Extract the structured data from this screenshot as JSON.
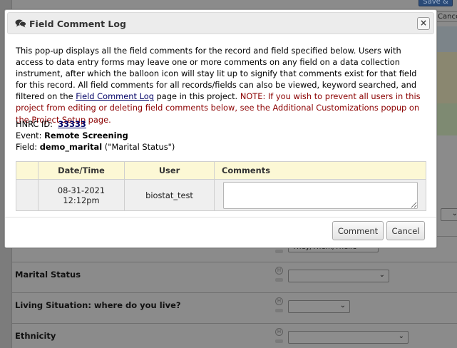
{
  "background": {
    "top_button_label": "Save &",
    "right_button_label": "Cancel",
    "select_partial_value": "They/Them/Theirs",
    "fields": [
      {
        "label": "Marital Status"
      },
      {
        "label": "Living Situation: where do you live?"
      },
      {
        "label": "Ethnicity"
      }
    ]
  },
  "dialog": {
    "title": "Field Comment Log",
    "close_label": "×",
    "intro_text": "This pop-up displays all the field comments for the record and field specified below. Users with access to data entry forms may leave one or more comments on any field on a data collection instrument, after which the balloon icon will stay lit up to signify that comments exist for that field for this record. All field comments for all records/fields can also be viewed, keyword searched, and filtered on the ",
    "intro_link": "Field Comment Log",
    "intro_tail": " page in this project. ",
    "note": "NOTE: If you wish to prevent all users in this project from editing or deleting field comments below, see the Additional Customizations popup on the Project Setup page.",
    "record_label": "HNRC ID:",
    "record_id": "33333",
    "event_label": "Event:",
    "event_value": "Remote Screening",
    "field_label": "Field:",
    "field_name": "demo_marital",
    "field_desc": "(\"Marital Status\")",
    "table": {
      "headers": [
        "",
        "Date/Time",
        "User",
        "Comments"
      ],
      "rows": [
        {
          "date": "08-31-2021",
          "time": "12:12pm",
          "user": "biostat_test",
          "comment": ""
        }
      ]
    },
    "buttons": {
      "comment": "Comment",
      "cancel": "Cancel"
    }
  }
}
